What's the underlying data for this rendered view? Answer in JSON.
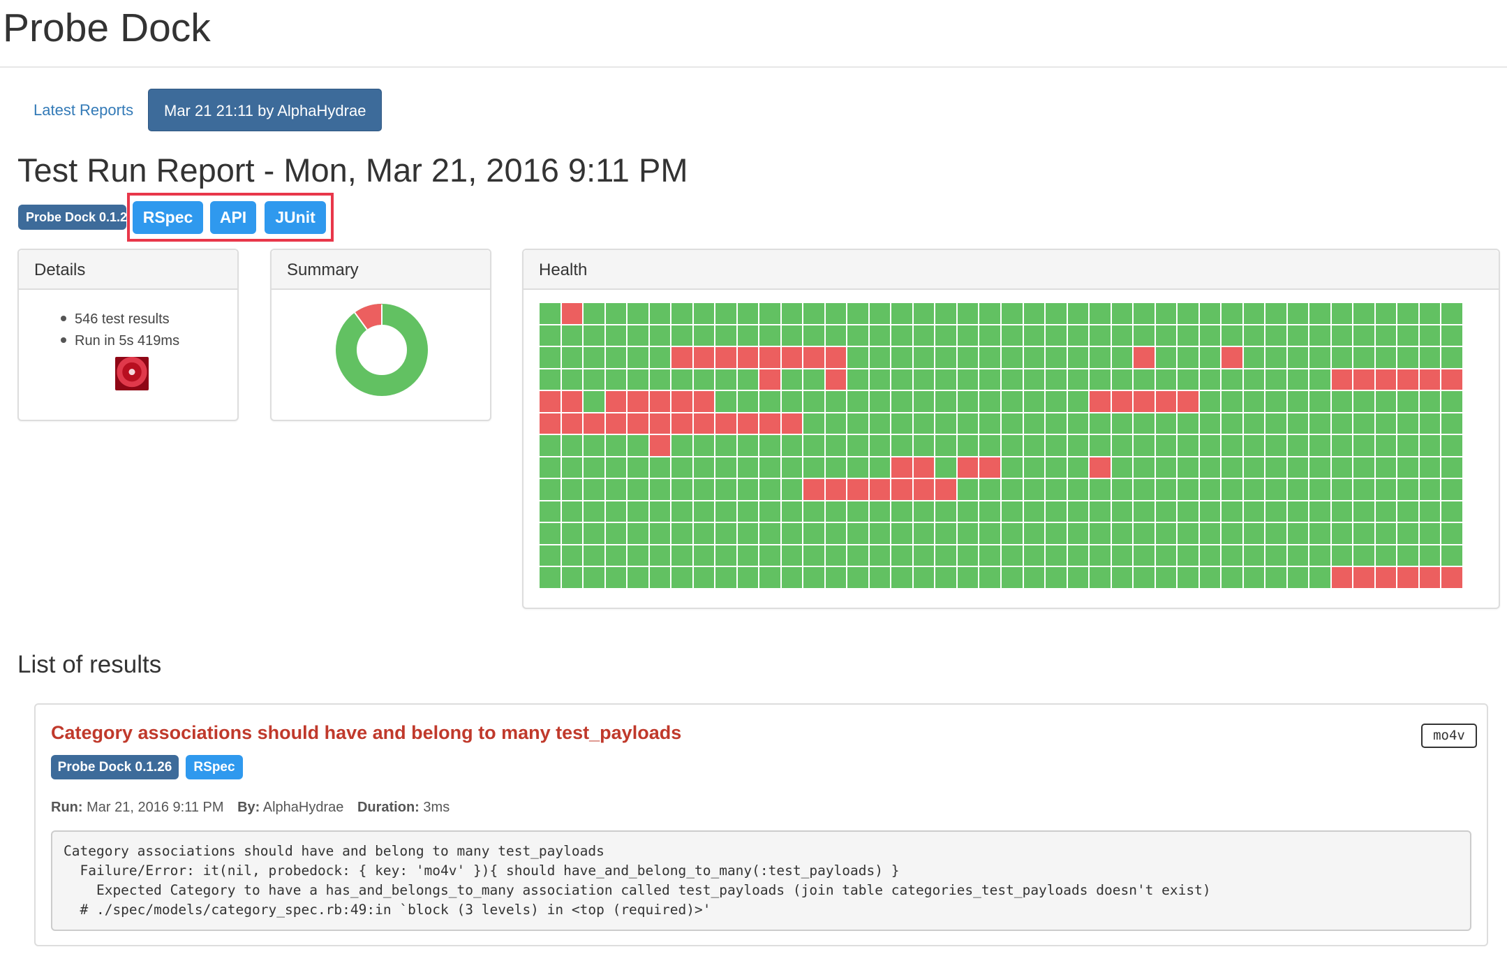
{
  "app": {
    "title": "Probe Dock"
  },
  "tabs": [
    {
      "label": "Latest Reports",
      "active": false
    },
    {
      "label": "Mar 21 21:11 by AlphaHydrae",
      "active": true
    }
  ],
  "report": {
    "title": "Test Run Report - Mon, Mar 21, 2016 9:11 PM",
    "labels": {
      "probe_dock": "Probe Dock 0.1.26",
      "categories": [
        "RSpec",
        "API",
        "JUnit"
      ]
    }
  },
  "details": {
    "heading": "Details",
    "items": [
      "546 test results",
      "Run in 5s 419ms"
    ]
  },
  "summary": {
    "heading": "Summary",
    "passed_fraction": 0.9,
    "failed_fraction": 0.1
  },
  "health": {
    "heading": "Health",
    "columns": 42,
    "rows": 13,
    "failed_cells": [
      [
        0,
        1
      ],
      [
        2,
        6
      ],
      [
        2,
        7
      ],
      [
        2,
        8
      ],
      [
        2,
        9
      ],
      [
        2,
        10
      ],
      [
        2,
        11
      ],
      [
        2,
        12
      ],
      [
        2,
        13
      ],
      [
        2,
        27
      ],
      [
        2,
        31
      ],
      [
        3,
        10
      ],
      [
        3,
        13
      ],
      [
        3,
        36
      ],
      [
        3,
        37
      ],
      [
        3,
        38
      ],
      [
        3,
        39
      ],
      [
        3,
        40
      ],
      [
        3,
        41
      ],
      [
        4,
        0
      ],
      [
        4,
        1
      ],
      [
        4,
        3
      ],
      [
        4,
        4
      ],
      [
        4,
        5
      ],
      [
        4,
        6
      ],
      [
        4,
        7
      ],
      [
        4,
        25
      ],
      [
        4,
        26
      ],
      [
        4,
        27
      ],
      [
        4,
        28
      ],
      [
        4,
        29
      ],
      [
        5,
        0
      ],
      [
        5,
        1
      ],
      [
        5,
        2
      ],
      [
        5,
        3
      ],
      [
        5,
        4
      ],
      [
        5,
        5
      ],
      [
        5,
        6
      ],
      [
        5,
        7
      ],
      [
        5,
        8
      ],
      [
        5,
        9
      ],
      [
        5,
        10
      ],
      [
        5,
        11
      ],
      [
        6,
        5
      ],
      [
        7,
        16
      ],
      [
        7,
        17
      ],
      [
        7,
        19
      ],
      [
        7,
        20
      ],
      [
        7,
        25
      ],
      [
        8,
        12
      ],
      [
        8,
        13
      ],
      [
        8,
        14
      ],
      [
        8,
        15
      ],
      [
        8,
        16
      ],
      [
        8,
        17
      ],
      [
        8,
        18
      ],
      [
        12,
        36
      ],
      [
        12,
        37
      ],
      [
        12,
        38
      ],
      [
        12,
        39
      ],
      [
        12,
        40
      ],
      [
        12,
        41
      ]
    ],
    "colors": {
      "passed": "#62c162",
      "failed": "#ec5f5f"
    }
  },
  "results": {
    "heading": "List of results",
    "items": [
      {
        "title": "Category associations should have and belong to many test_payloads",
        "key": "mo4v",
        "labels": {
          "probe_dock": "Probe Dock 0.1.26",
          "category": "RSpec"
        },
        "meta": {
          "run_label": "Run:",
          "run_value": "Mar 21, 2016 9:11 PM",
          "by_label": "By:",
          "by_value": "AlphaHydrae",
          "duration_label": "Duration:",
          "duration_value": "3ms"
        },
        "message": [
          "Category associations should have and belong to many test_payloads",
          "  Failure/Error: it(nil, probedock: { key: 'mo4v' }){ should have_and_belong_to_many(:test_payloads) }",
          "    Expected Category to have a has_and_belongs_to_many association called test_payloads (join table categories_test_payloads doesn't exist)",
          "  # ./spec/models/category_spec.rb:49:in `block (3 levels) in <top (required)>'"
        ]
      }
    ]
  },
  "colors": {
    "accent": "#337ab7",
    "probe_dock_label": "#3d6b9a",
    "category_label": "#2f99ee",
    "highlight": "#e8374a",
    "result_title": "#c0392b"
  }
}
